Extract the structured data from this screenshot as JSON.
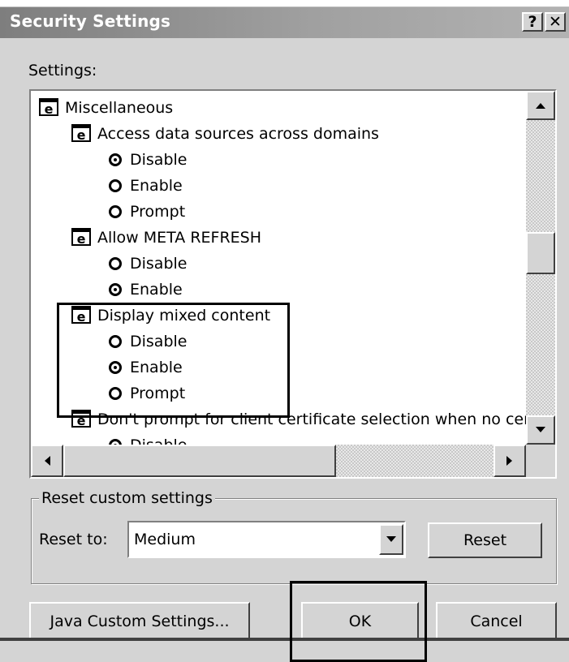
{
  "window": {
    "title": "Security Settings",
    "help_label": "?",
    "close_label": "✕"
  },
  "settings_label": "Settings:",
  "tree": [
    {
      "type": "category",
      "label": "Miscellaneous"
    },
    {
      "type": "setting",
      "label": "Access data sources across domains"
    },
    {
      "type": "option",
      "label": "Disable",
      "selected": true
    },
    {
      "type": "option",
      "label": "Enable",
      "selected": false
    },
    {
      "type": "option",
      "label": "Prompt",
      "selected": false
    },
    {
      "type": "setting",
      "label": "Allow META REFRESH"
    },
    {
      "type": "option",
      "label": "Disable",
      "selected": false
    },
    {
      "type": "option",
      "label": "Enable",
      "selected": true
    },
    {
      "type": "setting",
      "label": "Display mixed content"
    },
    {
      "type": "option",
      "label": "Disable",
      "selected": false
    },
    {
      "type": "option",
      "label": "Enable",
      "selected": true
    },
    {
      "type": "option",
      "label": "Prompt",
      "selected": false
    },
    {
      "type": "setting",
      "label": "Don't prompt for client certificate selection when no cer"
    },
    {
      "type": "option",
      "label": "Disable",
      "selected": true
    }
  ],
  "reset_group": {
    "legend": "Reset custom settings",
    "reset_to_label": "Reset to:",
    "selected_value": "Medium",
    "reset_button": "Reset"
  },
  "buttons": {
    "java": "Java Custom Settings...",
    "ok": "OK",
    "cancel": "Cancel"
  },
  "icons": {
    "ie": "ie-settings-icon",
    "up": "scroll-up-icon",
    "down": "scroll-down-icon",
    "left": "scroll-left-icon",
    "right": "scroll-right-icon",
    "dropdown": "chevron-down-icon"
  },
  "colors": {
    "dialog_bg": "#d4d4d4",
    "title_bg": "#8a8a8a",
    "list_bg": "#ffffff"
  }
}
